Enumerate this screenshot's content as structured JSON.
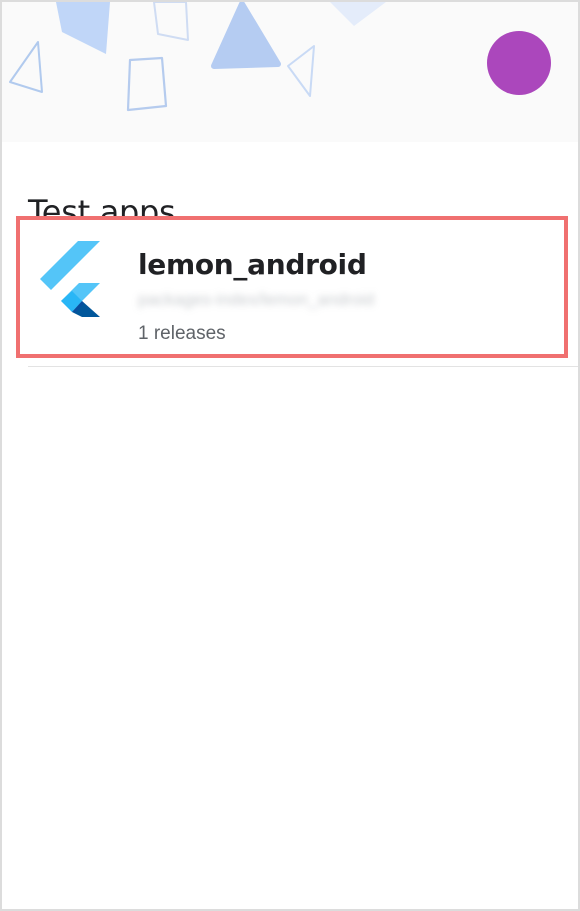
{
  "header": {
    "avatar_color": "#ab47bc"
  },
  "section": {
    "title": "Test apps"
  },
  "apps": [
    {
      "name": "lemon_android",
      "package": "packages-index/lemon_android",
      "releases": "1 releases",
      "icon": "flutter-logo-icon"
    }
  ],
  "colors": {
    "highlight_border": "#f07070",
    "logo_light": "#54c5f8",
    "logo_dark": "#01579b"
  }
}
